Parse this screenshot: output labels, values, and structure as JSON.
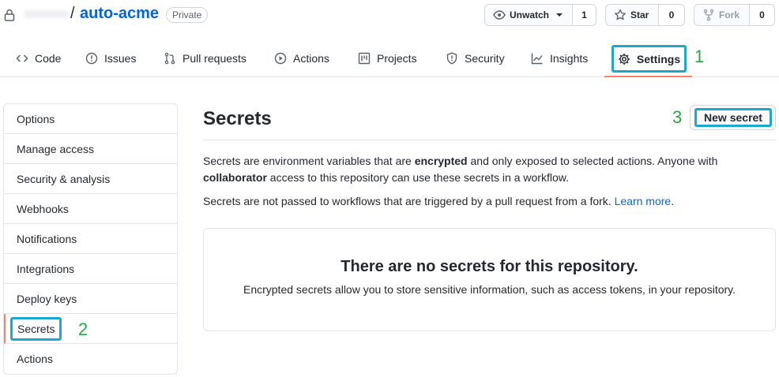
{
  "header": {
    "repo_name": "auto-acme",
    "separator": "/",
    "visibility_badge": "Private",
    "watch": {
      "label": "Unwatch",
      "count": "1"
    },
    "star": {
      "label": "Star",
      "count": "0"
    },
    "fork": {
      "label": "Fork",
      "count": "0"
    }
  },
  "tabs": [
    {
      "label": "Code",
      "icon": "code-icon"
    },
    {
      "label": "Issues",
      "icon": "issue-icon"
    },
    {
      "label": "Pull requests",
      "icon": "pull-request-icon"
    },
    {
      "label": "Actions",
      "icon": "play-icon"
    },
    {
      "label": "Projects",
      "icon": "project-icon"
    },
    {
      "label": "Security",
      "icon": "shield-icon"
    },
    {
      "label": "Insights",
      "icon": "graph-icon"
    },
    {
      "label": "Settings",
      "icon": "gear-icon",
      "selected": true
    }
  ],
  "annotations": {
    "step1": "1",
    "step2": "2",
    "step3": "3",
    "color": "#28a745",
    "highlight": "#1ea7cf"
  },
  "sidebar": {
    "items": [
      {
        "label": "Options"
      },
      {
        "label": "Manage access"
      },
      {
        "label": "Security & analysis"
      },
      {
        "label": "Webhooks"
      },
      {
        "label": "Notifications"
      },
      {
        "label": "Integrations"
      },
      {
        "label": "Deploy keys"
      },
      {
        "label": "Secrets",
        "selected": true
      },
      {
        "label": "Actions"
      }
    ]
  },
  "main": {
    "title": "Secrets",
    "new_button": "New secret",
    "desc_part1": "Secrets are environment variables that are ",
    "desc_bold1": "encrypted",
    "desc_part2": " and only exposed to selected actions. Anyone with ",
    "desc_bold2": "collaborator",
    "desc_part3": " access to this repository can use these secrets in a workflow.",
    "note": "Secrets are not passed to workflows that are triggered by a pull request from a fork. ",
    "learn_more": "Learn more",
    "note_end": ".",
    "empty_title": "There are no secrets for this repository.",
    "empty_sub": "Encrypted secrets allow you to store sensitive information, such as access tokens, in your repository."
  },
  "colors": {
    "link": "#0366d6",
    "active_underline": "#f9826c",
    "border": "#e1e4e8"
  }
}
